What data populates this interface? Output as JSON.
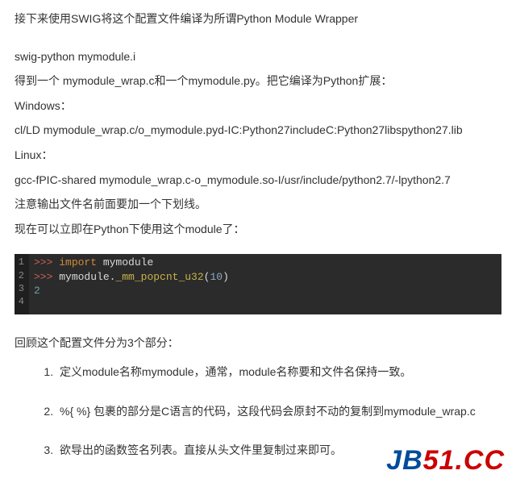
{
  "intro": "接下来使用SWIG将这个配置文件编译为所谓Python Module Wrapper",
  "lines": {
    "l1": "swig-python mymodule.i",
    "l2": "得到一个 mymodule_wrap.c和一个mymodule.py。把它编译为Python扩展：",
    "l3": "Windows：",
    "l4": "cl/LD mymodule_wrap.c/o_mymodule.pyd-IC:Python27includeC:Python27libspython27.lib",
    "l5": "Linux：",
    "l6": "gcc-fPIC-shared mymodule_wrap.c-o_mymodule.so-I/usr/include/python2.7/-lpython2.7",
    "l7": "注意输出文件名前面要加一个下划线。",
    "l8": "现在可以立即在Python下使用这个module了："
  },
  "code": {
    "g1": "1",
    "g2": "2",
    "g3": "3",
    "g4": "4",
    "p1a": ">>> ",
    "p1b": "import",
    "p1c": " mymodule",
    "p2a": ">>> ",
    "p2b": "mymodule.",
    "p2c": "_mm_popcnt_u32",
    "p2d": "(",
    "p2e": "10",
    "p2f": ")",
    "p3a": "2"
  },
  "review": "回顾这个配置文件分为3个部分：",
  "list": {
    "i1": "定义module名称mymodule，通常，module名称要和文件名保持一致。",
    "i2": "%{ %} 包裹的部分是C语言的代码，这段代码会原封不动的复制到mymodule_wrap.c",
    "i3": "欲导出的函数签名列表。直接从头文件里复制过来即可。"
  },
  "wm": {
    "a": "JB",
    "b": "51.CC"
  }
}
